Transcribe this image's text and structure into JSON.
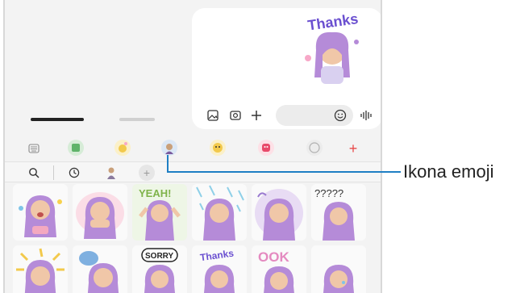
{
  "sent_sticker": {
    "caption": "Thanks"
  },
  "input": {
    "placeholder": ""
  },
  "toolbar": {
    "items": [
      {
        "name": "keyboard-icon",
        "color": "#9aa0a6"
      },
      {
        "name": "sticker-pack-icon",
        "color": "#5fb36a"
      },
      {
        "name": "animated-emoji-icon",
        "color": "#f2c94c"
      },
      {
        "name": "ar-emoji-icon",
        "color": "#7aa7d6"
      },
      {
        "name": "emoji-face-icon",
        "color": "#f2c94c"
      },
      {
        "name": "bitmoji-icon",
        "color": "#e84a6a"
      },
      {
        "name": "gif-icon",
        "color": "#b0b0b0"
      },
      {
        "name": "add-icon",
        "color": "#e84a4a"
      }
    ],
    "add_symbol": "+"
  },
  "search_row": {
    "add_symbol": "+"
  },
  "callout": {
    "label": "Ikona emoji"
  },
  "stickers": [
    {
      "caption": ""
    },
    {
      "caption": ""
    },
    {
      "caption": "YEAH!"
    },
    {
      "caption": ""
    },
    {
      "caption": ""
    },
    {
      "caption": "?????"
    },
    {
      "caption": ""
    },
    {
      "caption": ""
    },
    {
      "caption": "SORRY"
    },
    {
      "caption": "Thanks"
    },
    {
      "caption": "OOK"
    },
    {
      "caption": ""
    }
  ]
}
